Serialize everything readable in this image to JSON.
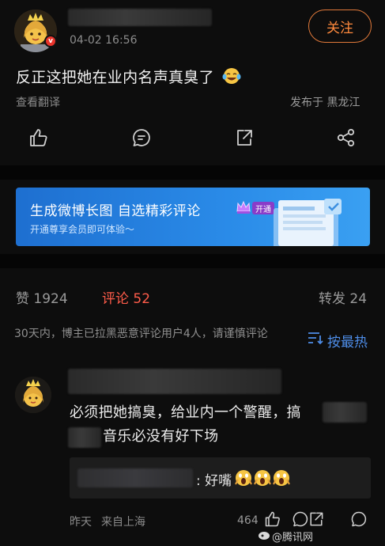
{
  "post": {
    "time": "04-02 16:56",
    "follow_label": "关注",
    "text": "反正这把她在业内名声真臭了",
    "translate_label": "查看翻译",
    "location_label": "发布于 黑龙江",
    "emoji_icon": "tears-of-joy-emoji"
  },
  "banner": {
    "title": "生成微博长图 自选精彩评论",
    "vip_label": "开通",
    "subtitle": "开通尊享会员即可体验～"
  },
  "stats": {
    "likes": "赞 1924",
    "comments": "评论 52",
    "reposts": "转发 24"
  },
  "notice": "30天内，博主已拉黑恶意评论用户4人，请谨慎评论",
  "sort_label": "按最热",
  "comment": {
    "text_line1": "必须把她搞臭，给业内一个警醒，搞",
    "text_line2": "音乐必没有好下场",
    "reply_text": ": 好嘴",
    "time": "昨天",
    "location": "来自上海",
    "like_count": "464"
  },
  "watermark": "@腾讯网"
}
